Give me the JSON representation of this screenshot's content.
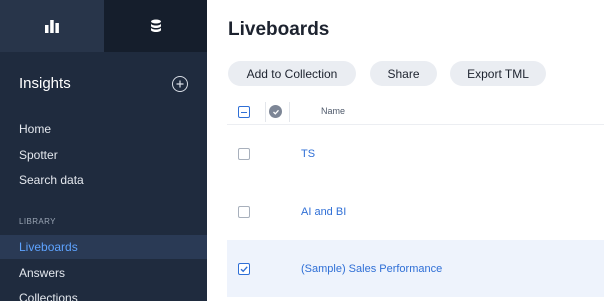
{
  "sidebar": {
    "title": "Insights",
    "nav": [
      "Home",
      "Spotter",
      "Search data"
    ],
    "section_label": "LIBRARY",
    "library": [
      "Liveboards",
      "Answers",
      "Collections"
    ],
    "active_item": "Liveboards"
  },
  "main": {
    "title": "Liveboards",
    "toolbar": {
      "add_to_collection": "Add to Collection",
      "share": "Share",
      "export": "Export TML"
    },
    "table": {
      "column_name": "Name",
      "rows": [
        {
          "name": "TS",
          "checked": false
        },
        {
          "name": "AI and BI",
          "checked": false
        },
        {
          "name": "(Sample) Sales Performance",
          "checked": true
        }
      ]
    }
  },
  "colors": {
    "sidebar_bg": "#1f2b3e",
    "active_bg": "#2a3a55",
    "link": "#2f6fd6",
    "selected_row": "#eef3fc"
  },
  "icons": [
    "bar-chart-icon",
    "database-icon",
    "plus-circle-icon",
    "verified-icon"
  ]
}
